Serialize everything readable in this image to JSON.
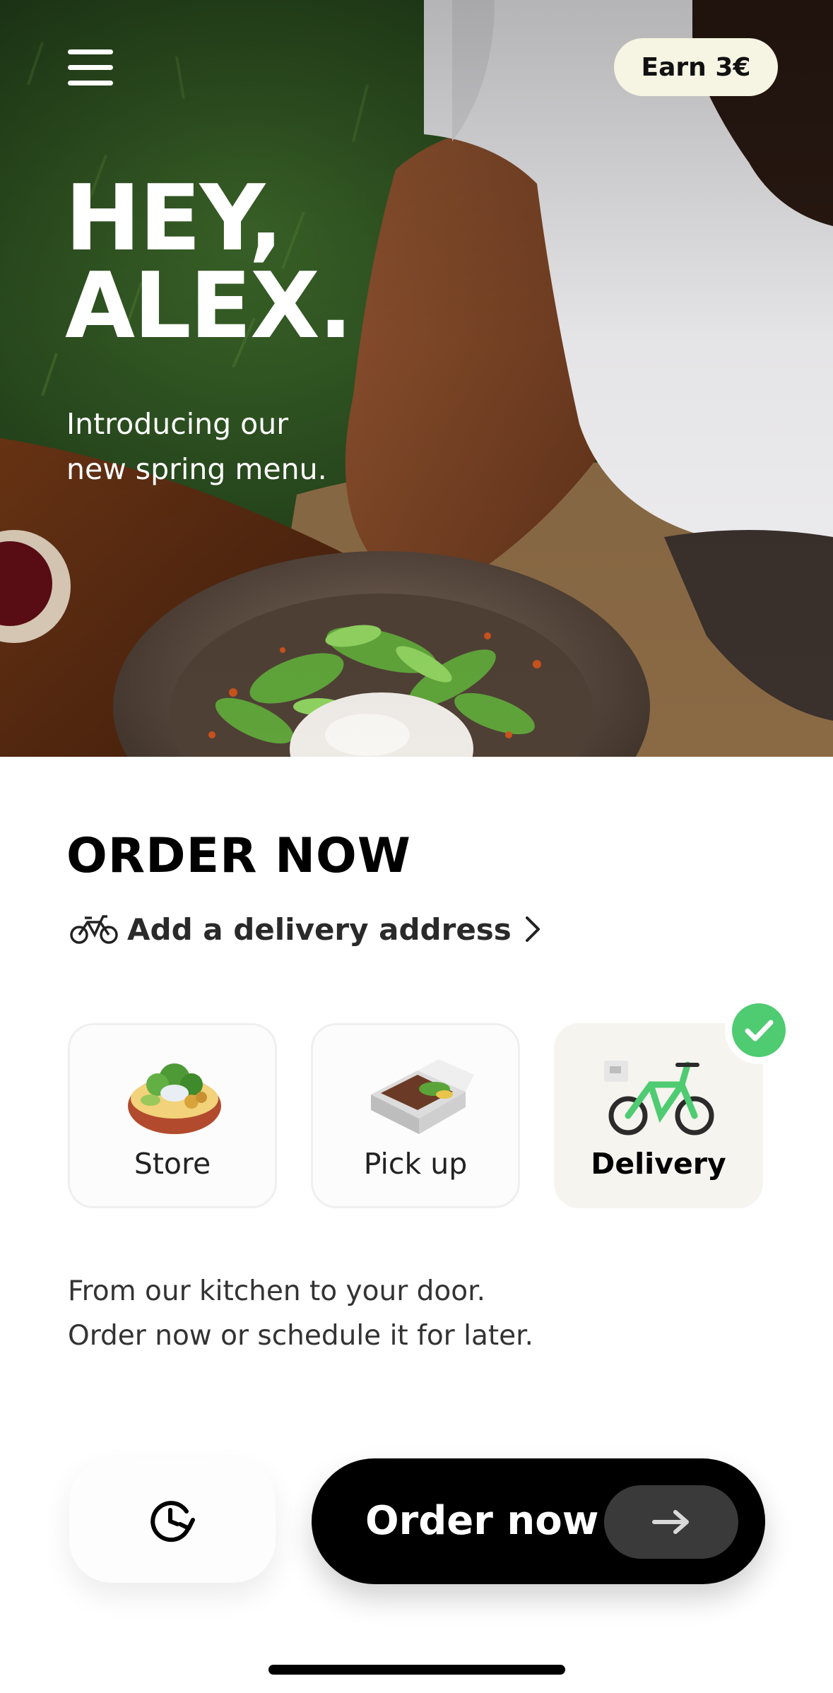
{
  "header": {
    "menu_icon": "hamburger-menu-icon",
    "earn_label": "Earn 3€"
  },
  "hero": {
    "greeting_line1": "HEY,",
    "greeting_line2": "ALEX.",
    "intro_line1": "Introducing our",
    "intro_line2": "new spring menu."
  },
  "order": {
    "title": "ORDER NOW",
    "address_icon": "bicycle-icon",
    "address_label": "Add a delivery address",
    "modes": [
      {
        "label": "Store",
        "icon": "salad-bowl-icon",
        "selected": false
      },
      {
        "label": "Pick up",
        "icon": "takeaway-box-icon",
        "selected": false
      },
      {
        "label": "Delivery",
        "icon": "delivery-bike-icon",
        "selected": true
      }
    ],
    "description_line1": "From our kitchen to your door.",
    "description_line2": "Order now or schedule it for later."
  },
  "actions": {
    "schedule_icon": "clock-refresh-icon",
    "order_label": "Order now",
    "arrow_icon": "arrow-right-icon"
  },
  "colors": {
    "accent_green": "#4fcb72",
    "pill_bg": "#f6f4e2",
    "primary_button": "#000000"
  }
}
